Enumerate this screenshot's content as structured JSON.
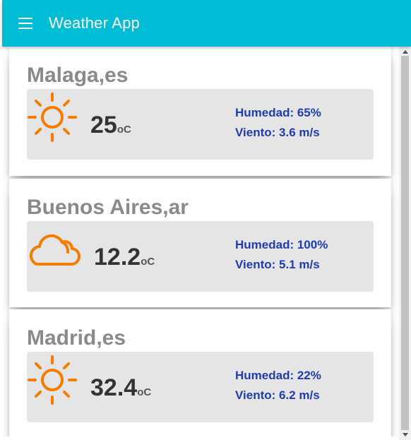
{
  "app": {
    "title": "Weather App"
  },
  "cards": [
    {
      "city": "Malaga,es",
      "icon": "sun-icon",
      "temp": "25",
      "unit": "oC",
      "humidity": "Humedad: 65%",
      "wind": "Viento: 3.6 m/s"
    },
    {
      "city": "Buenos Aires,ar",
      "icon": "cloud-icon",
      "temp": "12.2",
      "unit": "oC",
      "humidity": "Humedad: 100%",
      "wind": "Viento: 5.1 m/s"
    },
    {
      "city": "Madrid,es",
      "icon": "sun-icon",
      "temp": "32.4",
      "unit": "oC",
      "humidity": "Humedad: 22%",
      "wind": "Viento: 6.2 m/s"
    }
  ],
  "colors": {
    "app_bar": "#00bcd4",
    "icon_orange": "#f57c00",
    "stats_text": "#1e3cb4",
    "panel_bg": "#e5e5e5",
    "city_text": "#8a8a8a"
  }
}
